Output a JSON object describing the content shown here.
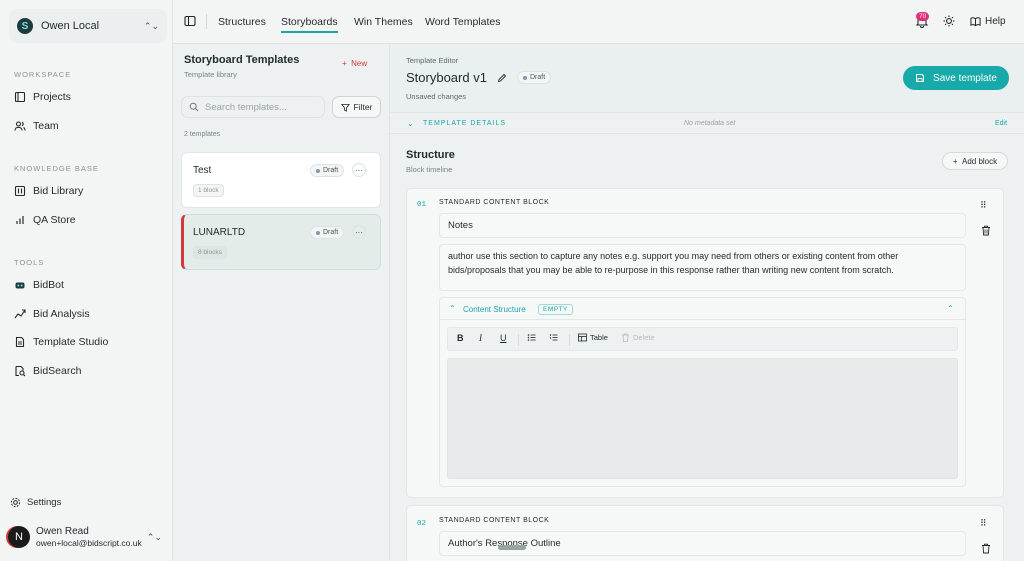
{
  "org": {
    "name": "Owen Local",
    "logo_letter": "S"
  },
  "sidebar": {
    "sections": [
      {
        "label": "WORKSPACE",
        "items": [
          {
            "label": "Projects",
            "icon": "book-icon"
          },
          {
            "label": "Team",
            "icon": "users-icon"
          }
        ]
      },
      {
        "label": "KNOWLEDGE BASE",
        "items": [
          {
            "label": "Bid Library",
            "icon": "library-icon"
          },
          {
            "label": "QA Store",
            "icon": "bar-chart-icon"
          }
        ]
      },
      {
        "label": "TOOLS",
        "items": [
          {
            "label": "BidBot",
            "icon": "bot-icon"
          },
          {
            "label": "Bid Analysis",
            "icon": "trend-icon"
          },
          {
            "label": "Template Studio",
            "icon": "file-icon"
          },
          {
            "label": "BidSearch",
            "icon": "search-doc-icon"
          }
        ]
      }
    ],
    "settings_label": "Settings",
    "user": {
      "initial": "N",
      "name": "Owen Read",
      "email": "owen+local@bidscript.co.uk"
    }
  },
  "topbar": {
    "tabs": [
      "Structures",
      "Storyboards",
      "Win Themes",
      "Word Templates"
    ],
    "active_tab": "Storyboards",
    "notification_count": "70",
    "help_label": "Help"
  },
  "templates": {
    "title": "Storyboard Templates",
    "subtitle": "Template library",
    "new_label": "New",
    "search_placeholder": "Search templates...",
    "filter_label": "Filter",
    "count_label": "2 templates",
    "items": [
      {
        "name": "Test",
        "status": "Draft",
        "blocks": "1 block",
        "selected": false
      },
      {
        "name": "LUNARLTD",
        "status": "Draft",
        "blocks": "8 blocks",
        "selected": true
      }
    ]
  },
  "editor": {
    "kicker": "Template Editor",
    "title": "Storyboard v1",
    "status": "Draft",
    "unsaved": "Unsaved changes",
    "save_label": "Save template",
    "details_label": "TEMPLATE DETAILS",
    "details_meta": "No metadata set",
    "details_edit": "Edit",
    "structure_title": "Structure",
    "structure_sub": "Block timeline",
    "add_block_label": "Add block",
    "blocks": [
      {
        "num": "01",
        "type": "STANDARD CONTENT BLOCK",
        "title": "Notes",
        "description": "author use this section to capture any notes e.g. support you may need from others or existing content from other bids/proposals that you may be able to re-purpose in this response rather than writing new content from scratch.",
        "content_structure": {
          "label": "Content Structure",
          "state": "EMPTY"
        },
        "toolbar": {
          "bold": "B",
          "italic": "I",
          "underline": "U",
          "table": "Table",
          "delete": "Delete"
        }
      },
      {
        "num": "02",
        "type": "STANDARD CONTENT BLOCK",
        "title": "Author's Response Outline"
      }
    ]
  },
  "colors": {
    "accent": "#18a9aa",
    "danger": "#d23a3a",
    "badge": "#e0307a"
  }
}
